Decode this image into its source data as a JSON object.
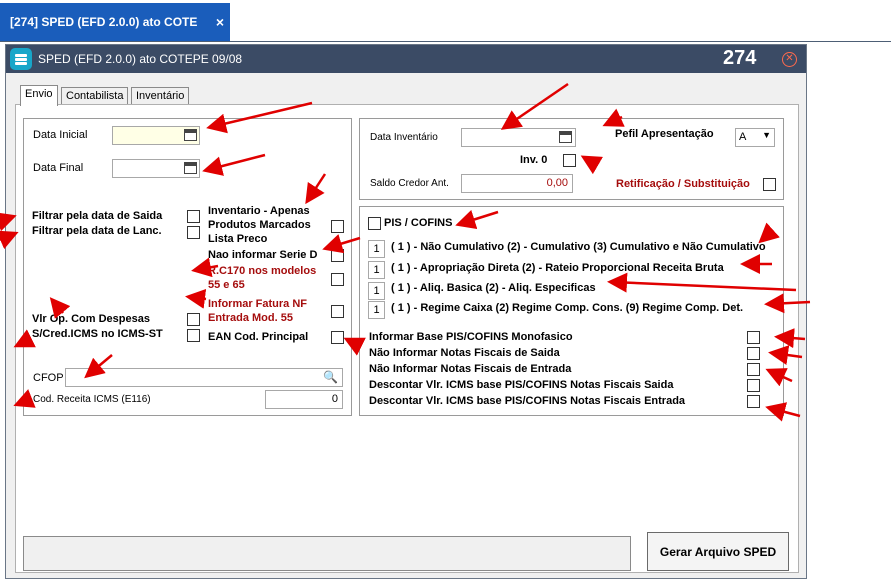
{
  "outer_tab": {
    "label": "[274] SPED (EFD 2.0.0) ato COTE",
    "close": "×"
  },
  "window": {
    "title": "SPED (EFD 2.0.0) ato COTEPE 09/08",
    "number": "274",
    "close": "✕"
  },
  "tabs": [
    "Envio",
    "Contabilista",
    "Inventário"
  ],
  "left": {
    "data_inicial": "Data Inicial",
    "data_final": "Data Final",
    "filtrar_saida": "Filtrar pela data de Saida",
    "filtrar_lanc": "Filtrar pela data de Lanc.",
    "inventario_apenas": "Inventario - Apenas",
    "produtos_marcados": "Produtos Marcados",
    "lista_preco": "Lista Preco",
    "nao_informar_serie": "Nao informar Serie D",
    "rc170_1": "R.C170 nos modelos",
    "rc170_2": "55 e 65",
    "informar_fatura_1": "Informar Fatura NF",
    "informar_fatura_2": "Entrada Mod. 55",
    "vlr_op": "Vlr Op. Com Despesas",
    "scred_icms": "S/Cred.ICMS no ICMS-ST",
    "ean": "EAN Cod. Principal",
    "cfop": "CFOP",
    "cod_receita": "Cod. Receita ICMS (E116)",
    "cod_receita_value": "0"
  },
  "right_top": {
    "data_inventario": "Data Inventário",
    "perfil": "Pefil Apresentação",
    "perfil_value": "A",
    "inv0": "Inv. 0",
    "saldo_credor": "Saldo Credor Ant.",
    "saldo_value": "0,00",
    "retificacao": "Retificação / Substituição"
  },
  "pis": {
    "title": "PIS / COFINS",
    "rows": [
      {
        "num": "1",
        "text": "( 1 ) - Não Cumulativo (2) - Cumulativo (3) Cumulativo e Não Cumulativo"
      },
      {
        "num": "1",
        "text": "( 1 ) - Apropriação Direta (2) - Rateio Proporcional Receita Bruta"
      },
      {
        "num": "1",
        "text": "( 1 ) - Aliq. Basica (2) - Aliq. Especificas"
      },
      {
        "num": "1",
        "text": "( 1 ) - Regime Caixa (2) Regime Comp. Cons. (9) Regime Comp. Det."
      }
    ],
    "opts": [
      "Informar Base PIS/COFINS Monofasico",
      "Não Informar Notas Fiscais de Saida",
      "Não Informar Notas Fiscais de Entrada",
      "Descontar Vlr. ICMS base PIS/COFINS Notas Fiscais Saida",
      "Descontar Vlr. ICMS base PIS/COFINS Notas Fiscais Entrada"
    ]
  },
  "button": "Gerar Arquivo SPED",
  "colors": {
    "accent": "#1a5dbb",
    "titlebar": "#3b4b65",
    "arrow": "#e00000",
    "red_label": "#a50d0d"
  }
}
